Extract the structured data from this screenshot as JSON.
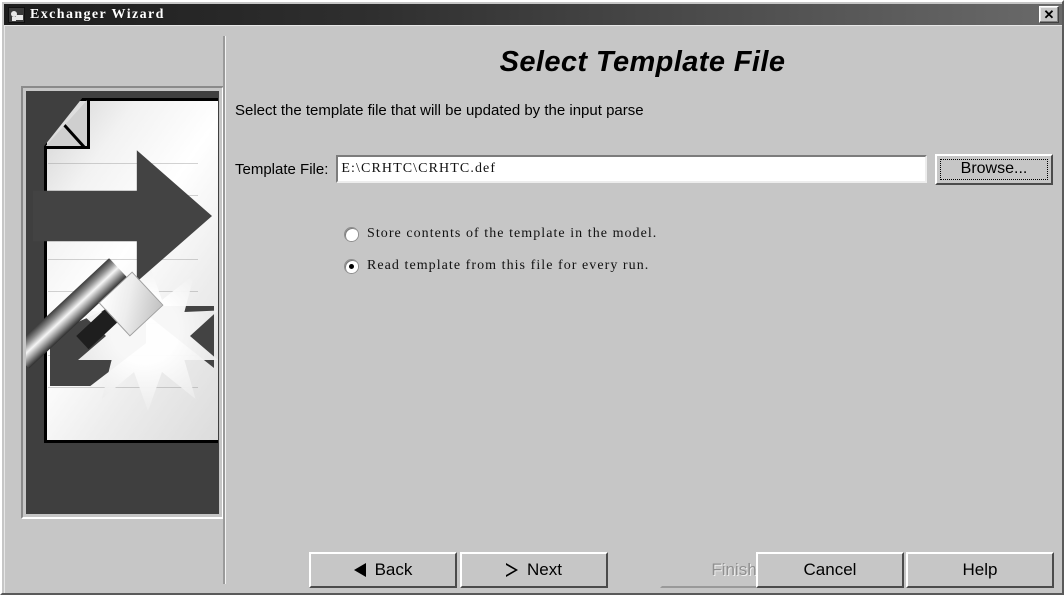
{
  "window": {
    "title": "Exchanger Wizard",
    "icon": "app-icon",
    "close_label": "✕"
  },
  "page": {
    "title": "Select Template File",
    "subtitle": "Select the template file that will be updated by the input parse"
  },
  "illustration": {
    "alt": "document-with-arrow-and-magic-wand"
  },
  "form": {
    "template_file": {
      "label": "Template File:",
      "value": "E:\\CRHTC\\CRHTC.def",
      "placeholder": ""
    },
    "browse_label": "Browse..."
  },
  "options": {
    "selected": "read_from_file",
    "items": [
      {
        "id": "store_in_model",
        "label": "Store contents of the template in the model.",
        "checked": false
      },
      {
        "id": "read_from_file",
        "label": "Read template from this file for every run.",
        "checked": true
      }
    ]
  },
  "buttons": {
    "back": {
      "label": "Back",
      "icon": "triangle-left-icon",
      "enabled": true
    },
    "next": {
      "label": "Next",
      "icon": "triangle-right-icon",
      "enabled": true
    },
    "finish": {
      "label": "Finish",
      "enabled": false
    },
    "cancel": {
      "label": "Cancel",
      "enabled": true
    },
    "help": {
      "label": "Help",
      "enabled": true
    }
  },
  "colors": {
    "face": "#c6c6c6",
    "titlebar_start": "#1d1d1d",
    "titlebar_end": "#6a6a6a",
    "text": "#000000",
    "disabled_text": "#909090",
    "field_bg": "#ffffff"
  }
}
